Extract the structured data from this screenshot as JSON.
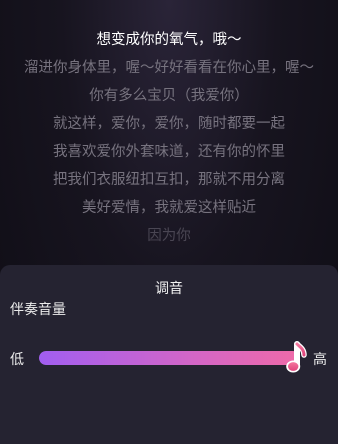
{
  "lyrics": [
    {
      "text": "想变成你的氧气，哦～",
      "current": true
    },
    {
      "text": "溜进你身体里，喔～好好看看在你心里，喔～",
      "current": false
    },
    {
      "text": "你有多么宝贝（我爱你）",
      "current": false
    },
    {
      "text": "就这样，爱你，爱你，随时都要一起",
      "current": false
    },
    {
      "text": "我喜欢爱你外套味道，还有你的怀里",
      "current": false
    },
    {
      "text": "把我们衣服纽扣互扣，那就不用分离",
      "current": false
    },
    {
      "text": "美好爱情，我就爱这样贴近",
      "current": false
    },
    {
      "text": "因为你",
      "current": false
    }
  ],
  "panel": {
    "title": "调音",
    "section_label": "伴奏音量",
    "low_label": "低",
    "high_label": "高",
    "accompaniment_volume_percent": 100
  },
  "colors": {
    "accent_start": "#a15ef0",
    "accent_end": "#ef6aa8"
  },
  "icons": {
    "slider_thumb": "music-note-icon"
  }
}
